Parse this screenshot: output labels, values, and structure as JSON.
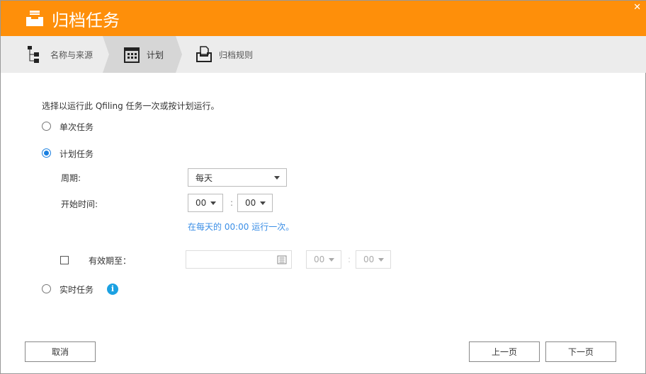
{
  "window": {
    "title": "归档任务",
    "close": "✕"
  },
  "steps": [
    {
      "label": "名称与来源"
    },
    {
      "label": "计划"
    },
    {
      "label": "归档规则"
    }
  ],
  "intro": "选择以运行此 Qfiling 任务一次或按计划运行。",
  "options": {
    "once": "单次任务",
    "scheduled": "计划任务",
    "realtime": "实时任务"
  },
  "schedule": {
    "period_label": "周期:",
    "period_value": "每天",
    "start_label": "开始时间:",
    "hour": "00",
    "minute": "00",
    "colon": ":",
    "summary": "在每天的 00:00 运行一次。",
    "expire_label": "有效期至：",
    "expire_date": "",
    "expire_hour": "00",
    "expire_minute": "00"
  },
  "buttons": {
    "cancel": "取消",
    "prev": "上一页",
    "next": "下一页"
  },
  "colors": {
    "header": "#fe8f0a",
    "accent": "#1a7fe0"
  }
}
